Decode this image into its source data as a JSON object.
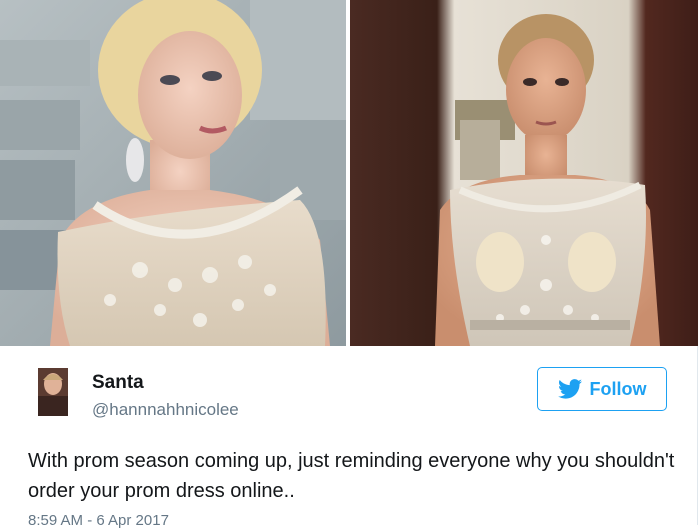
{
  "media": {
    "left_photo": {
      "icon": "model-photo"
    },
    "right_photo": {
      "icon": "customer-photo"
    }
  },
  "user": {
    "avatar_icon": "avatar-icon",
    "display_name": "Santa",
    "screen_name": "@hannnahhnicolee"
  },
  "follow": {
    "label": "Follow",
    "icon": "twitter-bird-icon",
    "color": "#1da1f2"
  },
  "tweet": {
    "text": "With prom season coming up, just reminding everyone why you shouldn't order your prom dress online..",
    "timestamp": "8:59 AM - 6 Apr 2017"
  },
  "colors": {
    "text": "#14171a",
    "secondary": "#657786",
    "accent": "#1da1f2"
  }
}
